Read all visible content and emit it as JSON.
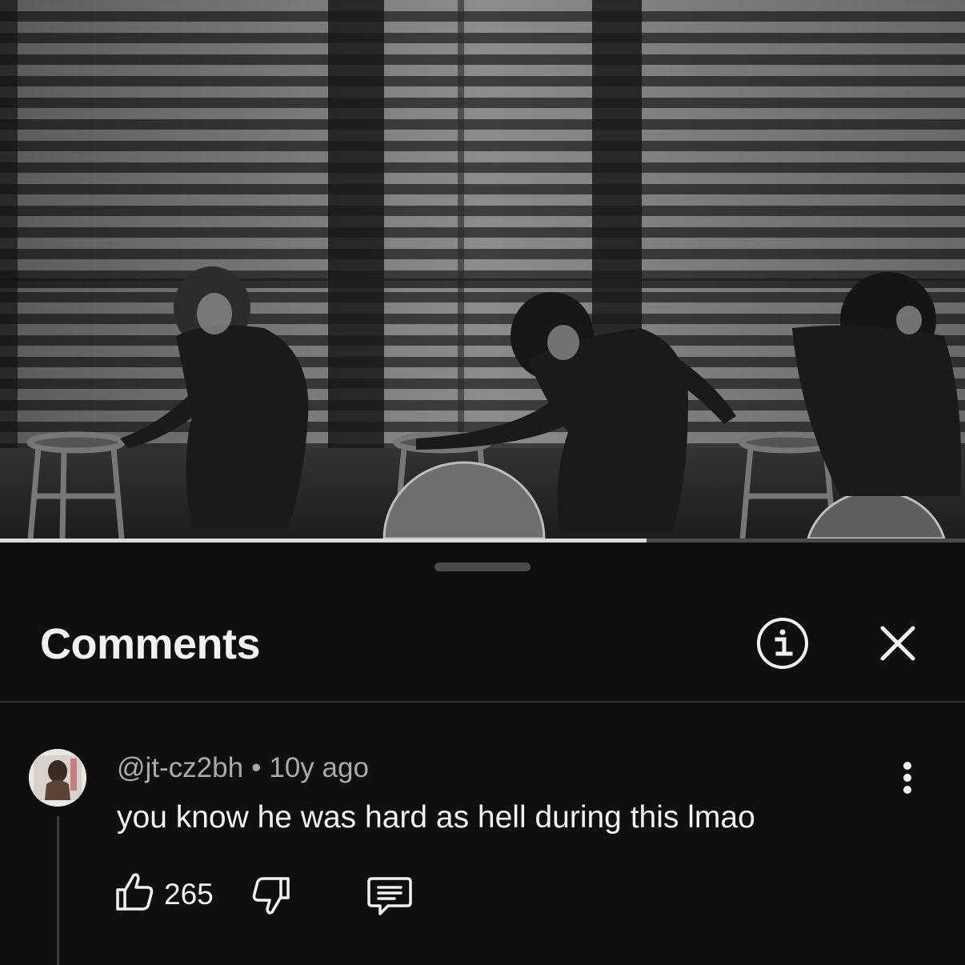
{
  "video": {
    "progress_fraction": 0.67
  },
  "comments_panel": {
    "title": "Comments",
    "info_icon": "info-icon",
    "close_icon": "close-icon"
  },
  "comment": {
    "author": "@jt-cz2bh",
    "separator": "•",
    "age": "10y ago",
    "text": "you know he was hard as hell during this lmao",
    "likes": "265",
    "like_icon": "thumbs-up-icon",
    "dislike_icon": "thumbs-down-icon",
    "reply_icon": "reply-icon",
    "more_icon": "more-vertical-icon"
  },
  "colors": {
    "background": "#0f0f0f",
    "text_primary": "#f1f1f1",
    "text_secondary": "#aaaaaa"
  }
}
